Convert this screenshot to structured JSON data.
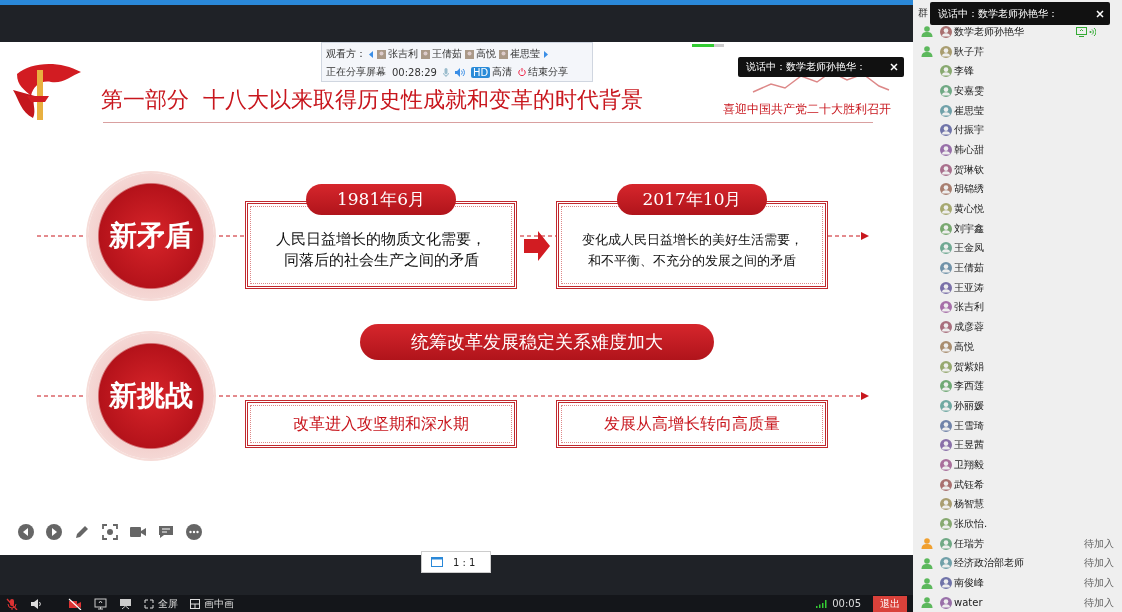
{
  "share_bar": {
    "viewers_label": "观看方：",
    "viewers": [
      "张吉利",
      "王倩茹",
      "高悦",
      "崔思莹"
    ],
    "status": "正在分享屏幕",
    "timer": "00:28:29",
    "quality_badge": "HD",
    "quality": "高清",
    "stop": "结束分享"
  },
  "audio_meter": {
    "level": 0.7
  },
  "slide_popup": {
    "text": "说话中：数学老师孙艳华："
  },
  "slide": {
    "title": "第一部分  十八大以来取得历史性成就和变革的时代背景",
    "subtitle": "喜迎中国共产党二十大胜利召开",
    "sections": [
      {
        "kind": "timeline",
        "label": "新矛盾",
        "periods": [
          {
            "date": "1981年6月",
            "lines": [
              "人民日益增长的物质文化需要，",
              "同落后的社会生产之间的矛盾"
            ]
          },
          {
            "date": "2017年10月",
            "lines": [
              "变化成人民日益增长的美好生活需要，",
              "和不平衡、不充分的发展之间的矛盾"
            ]
          }
        ]
      },
      {
        "kind": "summary",
        "label": "新挑战",
        "headline": "统筹改革发展稳定关系难度加大",
        "points": [
          "改革进入攻坚期和深水期",
          "发展从高增长转向高质量"
        ]
      }
    ]
  },
  "zoom_ratio": "1 : 1",
  "bottom_bar": {
    "mic_muted": true,
    "camera_off": true,
    "fullscreen": "全屏",
    "pip": "画中画",
    "duration": "00:05",
    "exit": "退出"
  },
  "sidebar": {
    "tab_label": "群",
    "popup": "说话中：数学老师孙艳华：",
    "members": [
      {
        "name": "数学老师孙艳华",
        "color": "#5cb85c",
        "sharing": true,
        "speaking": true
      },
      {
        "name": "耿子芹",
        "color": "#5cb85c",
        "sharing": false,
        "speaking": false
      },
      {
        "name": "李锋",
        "sharing": false,
        "speaking": false
      },
      {
        "name": "安嘉雯",
        "sharing": false,
        "speaking": false
      },
      {
        "name": "崔思莹",
        "sharing": false,
        "speaking": false
      },
      {
        "name": "付振宇",
        "sharing": false,
        "speaking": false
      },
      {
        "name": "韩心甜",
        "sharing": false,
        "speaking": false
      },
      {
        "name": "贺琳钦",
        "sharing": false,
        "speaking": false
      },
      {
        "name": "胡锦绣",
        "sharing": false,
        "speaking": false
      },
      {
        "name": "黄心悦",
        "sharing": false,
        "speaking": false
      },
      {
        "name": "刘宇鑫",
        "sharing": false,
        "speaking": false
      },
      {
        "name": "王金凤",
        "sharing": false,
        "speaking": false
      },
      {
        "name": "王倩茹",
        "sharing": false,
        "speaking": false
      },
      {
        "name": "王亚涛",
        "sharing": false,
        "speaking": false
      },
      {
        "name": "张吉利",
        "sharing": false,
        "speaking": false
      },
      {
        "name": "成彦蓉",
        "sharing": false,
        "speaking": false
      },
      {
        "name": "高悦",
        "sharing": false,
        "speaking": false
      },
      {
        "name": "贺紫娟",
        "sharing": false,
        "speaking": false
      },
      {
        "name": "李西莲",
        "sharing": false,
        "speaking": false
      },
      {
        "name": "孙丽媛",
        "sharing": false,
        "speaking": false
      },
      {
        "name": "王雪琦",
        "sharing": false,
        "speaking": false
      },
      {
        "name": "王昱茜",
        "sharing": false,
        "speaking": false
      },
      {
        "name": "卫翔毅",
        "sharing": false,
        "speaking": false
      },
      {
        "name": "武钰希",
        "sharing": false,
        "speaking": false
      },
      {
        "name": "杨智慧",
        "sharing": false,
        "speaking": false
      },
      {
        "name": "张欣怡.",
        "sharing": false,
        "speaking": false
      },
      {
        "name": "任瑞芳",
        "color": "#f0a030",
        "status": "待加入",
        "sharing": false,
        "speaking": false
      },
      {
        "name": "经济政治部老师",
        "color": "#5cb85c",
        "status": "待加入",
        "sharing": false,
        "speaking": false
      },
      {
        "name": "南俊峰",
        "color": "#5cb85c",
        "status": "待加入",
        "sharing": false,
        "speaking": false
      },
      {
        "name": "water",
        "color": "#5cb85c",
        "status": "待加入",
        "sharing": false,
        "speaking": false
      }
    ]
  }
}
